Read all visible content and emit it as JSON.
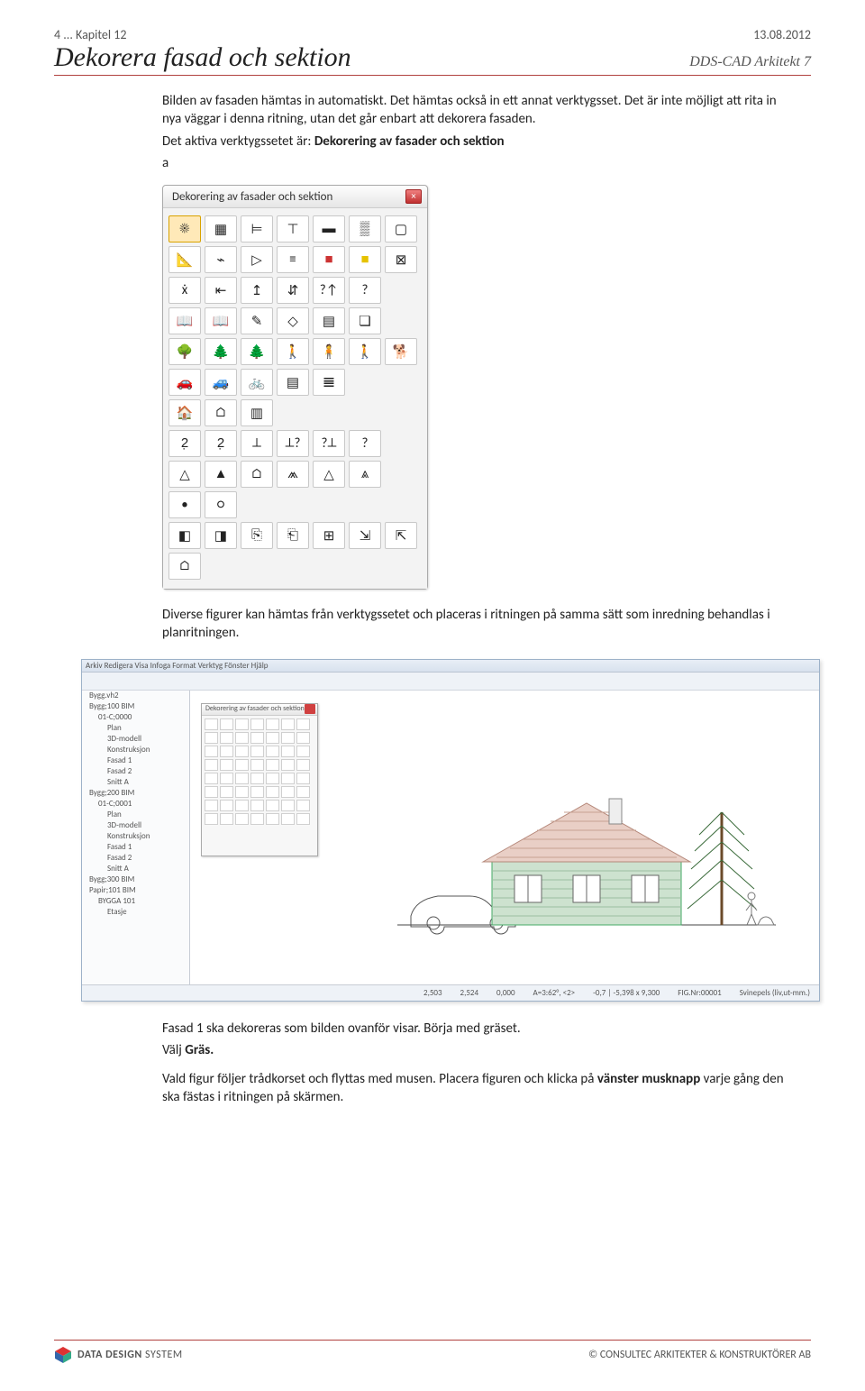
{
  "header": {
    "left": "4 ... Kapitel 12",
    "right": "13.08.2012"
  },
  "titlebar": {
    "title": "Dekorera fasad och sektion",
    "product": "DDS-CAD Arkitekt 7"
  },
  "para_intro": [
    "Bilden av fasaden hämtas in automatiskt. Det hämtas också in ett annat verktygsset. Det är inte möjligt att rita in nya väggar i denna ritning, utan det går enbart att dekorera fasaden.",
    "Det aktiva verktygssetet är:",
    "a"
  ],
  "intro_bold": "Dekorering av fasader och sektion",
  "palette": {
    "title": "Dekorering av fasader och sektion",
    "close": "×",
    "tools": [
      {
        "n": "sun-dashed",
        "g": "☀",
        "sel": true
      },
      {
        "n": "grid-orange",
        "g": "▦"
      },
      {
        "n": "split-green",
        "g": "⊨"
      },
      {
        "n": "dimension",
        "g": "⊤"
      },
      {
        "n": "lines-blue",
        "g": "▬"
      },
      {
        "n": "fill-pattern",
        "g": "▒"
      },
      {
        "n": "window-blue",
        "g": "▢"
      },
      {
        "n": "angle",
        "g": "📐"
      },
      {
        "n": "zigzag",
        "g": "⌁"
      },
      {
        "n": "triangle-right",
        "g": "▷"
      },
      {
        "n": "lines-thin",
        "g": "≡"
      },
      {
        "n": "fill-red",
        "g": "■",
        "c": "#c33"
      },
      {
        "n": "fill-yellow",
        "g": "■",
        "c": "#e6c200"
      },
      {
        "n": "cross-box",
        "g": "⊠"
      },
      {
        "n": "level-xxx",
        "g": "ẋ"
      },
      {
        "n": "flip-h",
        "g": "⇤"
      },
      {
        "n": "arrow-up",
        "g": "↥"
      },
      {
        "n": "arrows-updown",
        "g": "⇵"
      },
      {
        "n": "arrow-q-up",
        "g": "?↑"
      },
      {
        "n": "arrow-q",
        "g": "?"
      },
      {
        "n": "gap-a",
        "g": ""
      },
      {
        "n": "book-open",
        "g": "📖"
      },
      {
        "n": "book-2",
        "g": "📖"
      },
      {
        "n": "pencil",
        "g": "✎"
      },
      {
        "n": "shape-n",
        "g": "◇"
      },
      {
        "n": "sheet",
        "g": "▤"
      },
      {
        "n": "box3d",
        "g": "❏"
      },
      {
        "n": "gap-b",
        "g": ""
      },
      {
        "n": "bush-lg",
        "g": "🌳"
      },
      {
        "n": "shrub",
        "g": "🌲"
      },
      {
        "n": "tree-pine",
        "g": "🌲"
      },
      {
        "n": "person-blue",
        "g": "🚶"
      },
      {
        "n": "person-grey",
        "g": "🧍"
      },
      {
        "n": "person-walk",
        "g": "🚶"
      },
      {
        "n": "dog",
        "g": "🐕"
      },
      {
        "n": "car-red",
        "g": "🚗"
      },
      {
        "n": "car-blue",
        "g": "🚙"
      },
      {
        "n": "bicycle",
        "g": "🚲"
      },
      {
        "n": "hatch-lines",
        "g": "▤"
      },
      {
        "n": "fence",
        "g": "𝌆"
      },
      {
        "n": "gap-c",
        "g": ""
      },
      {
        "n": "gap-d",
        "g": ""
      },
      {
        "n": "house-fill",
        "g": "🏠"
      },
      {
        "n": "house-red",
        "g": "⌂"
      },
      {
        "n": "layers",
        "g": "▥"
      },
      {
        "n": "gap-e",
        "g": ""
      },
      {
        "n": "gap-f",
        "g": ""
      },
      {
        "n": "gap-g",
        "g": ""
      },
      {
        "n": "gap-h",
        "g": ""
      },
      {
        "n": "num-2-1",
        "g": "2̣"
      },
      {
        "n": "num-2-2",
        "g": "2̣"
      },
      {
        "n": "dim-ext1",
        "g": "⟂"
      },
      {
        "n": "dim-ext2",
        "g": "⟂?"
      },
      {
        "n": "dim-ext3",
        "g": "?⟂"
      },
      {
        "n": "dim-ext4",
        "g": "?"
      },
      {
        "n": "gap-i",
        "g": ""
      },
      {
        "n": "roof1",
        "g": "△"
      },
      {
        "n": "roof2",
        "g": "▲"
      },
      {
        "n": "roof3",
        "g": "⌂"
      },
      {
        "n": "roof4",
        "g": "⩕"
      },
      {
        "n": "roof5",
        "g": "△"
      },
      {
        "n": "roof6",
        "g": "⩓"
      },
      {
        "n": "gap-j",
        "g": ""
      },
      {
        "n": "point",
        "g": "•"
      },
      {
        "n": "point2",
        "g": "○"
      },
      {
        "n": "gap-k",
        "g": ""
      },
      {
        "n": "gap-l",
        "g": ""
      },
      {
        "n": "gap-m",
        "g": ""
      },
      {
        "n": "gap-n",
        "g": ""
      },
      {
        "n": "gap-o",
        "g": ""
      },
      {
        "n": "eraser-g",
        "g": "◧"
      },
      {
        "n": "eraser-r",
        "g": "◨"
      },
      {
        "n": "copy-doc",
        "g": "⎘"
      },
      {
        "n": "paste-doc",
        "g": "⎗"
      },
      {
        "n": "props",
        "g": "⊞"
      },
      {
        "n": "send-back",
        "g": "⇲"
      },
      {
        "n": "bring-front",
        "g": "⇱"
      },
      {
        "n": "roof-button",
        "g": "⌂"
      },
      {
        "n": "gap-p",
        "g": ""
      },
      {
        "n": "gap-q",
        "g": ""
      },
      {
        "n": "gap-r",
        "g": ""
      },
      {
        "n": "gap-s",
        "g": ""
      },
      {
        "n": "gap-t",
        "g": ""
      },
      {
        "n": "gap-u",
        "g": ""
      }
    ]
  },
  "para_diverse": "Diverse figurer kan hämtas från verktygssetet och placeras i ritningen på samma sätt som inredning behandlas i planritningen.",
  "cad": {
    "menubar": "Arkiv  Redigera  Visa  Infoga  Format  Verktyg  Fönster  Hjälp",
    "mini_palette_title": "Dekorering av fasader och sektion",
    "tree": [
      {
        "t": "Bygg.vh2",
        "i": 0
      },
      {
        "t": "Bygg;100 BIM",
        "i": 0
      },
      {
        "t": "01-C;0000",
        "i": 1
      },
      {
        "t": "Plan",
        "i": 2
      },
      {
        "t": "3D-modell",
        "i": 2
      },
      {
        "t": "Konstruksjon",
        "i": 2
      },
      {
        "t": "Fasad 1",
        "i": 2
      },
      {
        "t": "Fasad 2",
        "i": 2
      },
      {
        "t": "Snitt A",
        "i": 2
      },
      {
        "t": "Bygg;200 BIM",
        "i": 0
      },
      {
        "t": "01-C;0001",
        "i": 1
      },
      {
        "t": "Plan",
        "i": 2
      },
      {
        "t": "3D-modell",
        "i": 2
      },
      {
        "t": "Konstruksjon",
        "i": 2
      },
      {
        "t": "Fasad 1",
        "i": 2
      },
      {
        "t": "Fasad 2",
        "i": 2
      },
      {
        "t": "Snitt A",
        "i": 2
      },
      {
        "t": "Bygg;300 BIM",
        "i": 0
      },
      {
        "t": "Papir;101 BIM",
        "i": 0
      },
      {
        "t": "BYGGA 101",
        "i": 1
      },
      {
        "t": "Etasje",
        "i": 2
      }
    ],
    "status": [
      "2,503",
      "2,524",
      "0,000",
      "A=3:62°, <2>",
      "-0,7 | -5,398 x 9,300",
      "FIG.Nr:00001",
      "Svinepels (liv,ut-mm.)"
    ]
  },
  "para_fasad": [
    "Fasad 1 ska dekoreras som bilden ovanför visar. Börja med gräset.",
    "Välj ",
    "Vald figur följer trådkorset och flyttas med musen. Placera figuren och klicka på ",
    " varje gång den ska fästas i ritningen på skärmen."
  ],
  "para_fasad_bold": {
    "gras": "Gräs.",
    "vmus": "vänster musknapp"
  },
  "footer": {
    "brand_bold": "DATA DESIGN",
    "brand_light": " SYSTEM",
    "right": "©   CONSULTEC ARKITEKTER & KONSTRUKTÖRER AB"
  }
}
